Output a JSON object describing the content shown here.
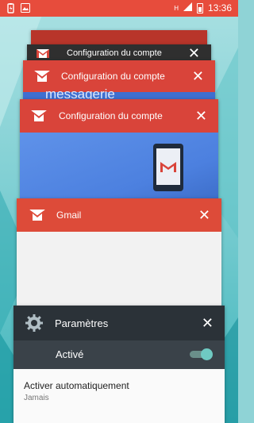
{
  "status_bar": {
    "time": "13:36",
    "network": "H"
  },
  "recents": [
    {
      "app": "gmail",
      "title": ""
    },
    {
      "app": "gmail",
      "title": "Configuration du compte"
    },
    {
      "app": "gmail",
      "title": "Configuration du compte",
      "peek_text": "messagerie"
    },
    {
      "app": "gmail",
      "title": "Configuration du compte"
    },
    {
      "app": "gmail",
      "title": "Gmail"
    },
    {
      "app": "settings",
      "title": "Paramètres"
    }
  ],
  "settings_card": {
    "toggle_label": "Activé",
    "toggle_on": true,
    "item_title": "Activer automatiquement",
    "item_subtitle": "Jamais"
  },
  "colors": {
    "status_bar": "#e74c3c",
    "gmail_header": "#dd4b39",
    "settings_header": "#2b3238",
    "accent": "#6fcac2"
  }
}
